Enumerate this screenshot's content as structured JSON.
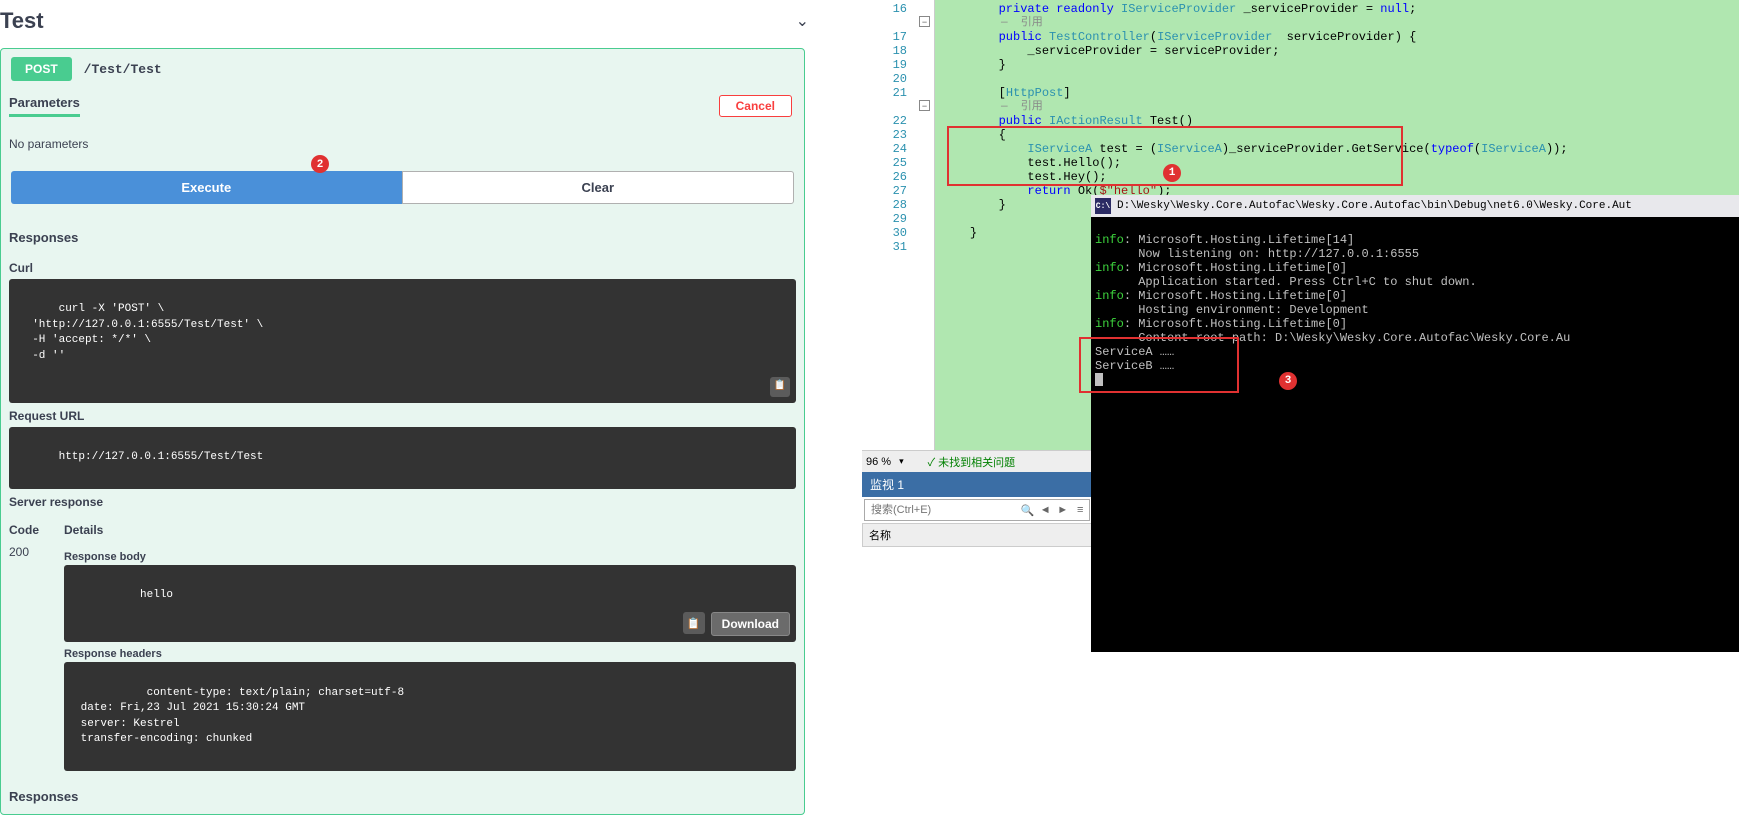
{
  "swagger": {
    "title": "Test",
    "method": "POST",
    "path": "/Test/Test",
    "params_tab": "Parameters",
    "cancel": "Cancel",
    "no_params": "No parameters",
    "badge2": "2",
    "execute": "Execute",
    "clear": "Clear",
    "responses": "Responses",
    "curl_label": "Curl",
    "curl_text": "curl -X 'POST' \\\n  'http://127.0.0.1:6555/Test/Test' \\\n  -H 'accept: */*' \\\n  -d ''",
    "req_url_label": "Request URL",
    "req_url": "http://127.0.0.1:6555/Test/Test",
    "server_resp_label": "Server response",
    "code_hdr": "Code",
    "details_hdr": "Details",
    "code_200": "200",
    "resp_body_label": "Response body",
    "resp_body": "hello",
    "download": "Download",
    "resp_headers_label": "Response headers",
    "resp_headers": " content-type: text/plain; charset=utf-8 \n date: Fri,23 Jul 2021 15:30:24 GMT \n server: Kestrel \n transfer-encoding: chunked ",
    "responses_bottom": "Responses"
  },
  "code": {
    "line_start": 16,
    "line_end": 31,
    "ref_hint": "—  引用",
    "badge1": "1",
    "l16a": "private readonly ",
    "l16b": "IServiceProvider",
    "l16c": " _serviceProvider = ",
    "l16d": "null",
    "l16e": ";",
    "l17a": "public ",
    "l17b": "TestController",
    "l17c": "(",
    "l17d": "IServiceProvider",
    "l17e": "  serviceProvider) {",
    "l18": "    _serviceProvider = serviceProvider;",
    "l19": "}",
    "l20": "",
    "l21a": "[",
    "l21b": "HttpPost",
    "l21c": "]",
    "l22a": "public ",
    "l22b": "IActionResult",
    "l22c": " Test()",
    "l23": "{",
    "l24a": "    ",
    "l24b": "IServiceA",
    "l24c": " test = (",
    "l24d": "IServiceA",
    "l24e": ")_serviceProvider.GetService(",
    "l24f": "typeof",
    "l24g": "(",
    "l24h": "IServiceA",
    "l24i": "));",
    "l25": "    test.Hello();",
    "l26": "    test.Hey();",
    "l27a": "    ",
    "l27b": "return",
    "l27c": " Ok(",
    "l27d": "$\"hello\"",
    "l27e": ");",
    "l28": "}",
    "l29": "",
    "l30": "}",
    "l31": ""
  },
  "vs": {
    "zoom": "96 %",
    "no_issues": "✓ 未找到相关问题",
    "watch_header": "监视 1",
    "search_placeholder": "搜索(Ctrl+E)",
    "name_col": "名称"
  },
  "console": {
    "title": "D:\\Wesky\\Wesky.Core.Autofac\\Wesky.Core.Autofac\\bin\\Debug\\net6.0\\Wesky.Core.Aut",
    "lines": [
      "info: Microsoft.Hosting.Lifetime[14]",
      "      Now listening on: http://127.0.0.1:6555",
      "info: Microsoft.Hosting.Lifetime[0]",
      "      Application started. Press Ctrl+C to shut down.",
      "info: Microsoft.Hosting.Lifetime[0]",
      "      Hosting environment: Development",
      "info: Microsoft.Hosting.Lifetime[0]",
      "      Content root path: D:\\Wesky\\Wesky.Core.Autofac\\Wesky.Core.Au",
      "ServiceA ……",
      "ServiceB ……"
    ],
    "badge3": "3",
    "icon": "C:\\"
  }
}
